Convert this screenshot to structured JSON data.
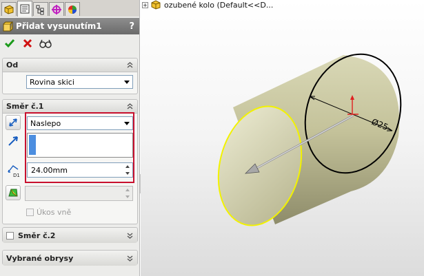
{
  "feature_manager": {
    "tabs": [
      {
        "name": "feature-manager-tab-icon"
      },
      {
        "name": "property-manager-tab-icon"
      },
      {
        "name": "configuration-manager-tab-icon"
      },
      {
        "name": "dimxpert-manager-tab-icon"
      },
      {
        "name": "display-manager-tab-icon"
      }
    ],
    "active_tab": 1
  },
  "property_manager": {
    "title": "Přidat vysunutím1",
    "help": "?",
    "actions": [
      "ok-check-icon",
      "cancel-x-icon",
      "preview-glasses-icon"
    ]
  },
  "groups": {
    "from": {
      "title": "Od",
      "start_condition": "Rovina skici"
    },
    "direction1": {
      "title": "Směr č.1",
      "end_condition": "Naslepo",
      "depth": "24.00mm",
      "draft_value": "",
      "draft_outward_label": "Úkos vně"
    },
    "direction2": {
      "title": "Směr č.2"
    },
    "selected_contours": {
      "title": "Vybrané obrysy"
    }
  },
  "viewport": {
    "tree_item": "ozubené kolo  (Default<<D...",
    "dimension_label": "Ø25",
    "colors": {
      "cylinder_body": "#c9c7a2",
      "front_face_outline": "#ffff00",
      "preview_arrow": "#9a9a9a",
      "origin_red": "#e02020"
    }
  }
}
